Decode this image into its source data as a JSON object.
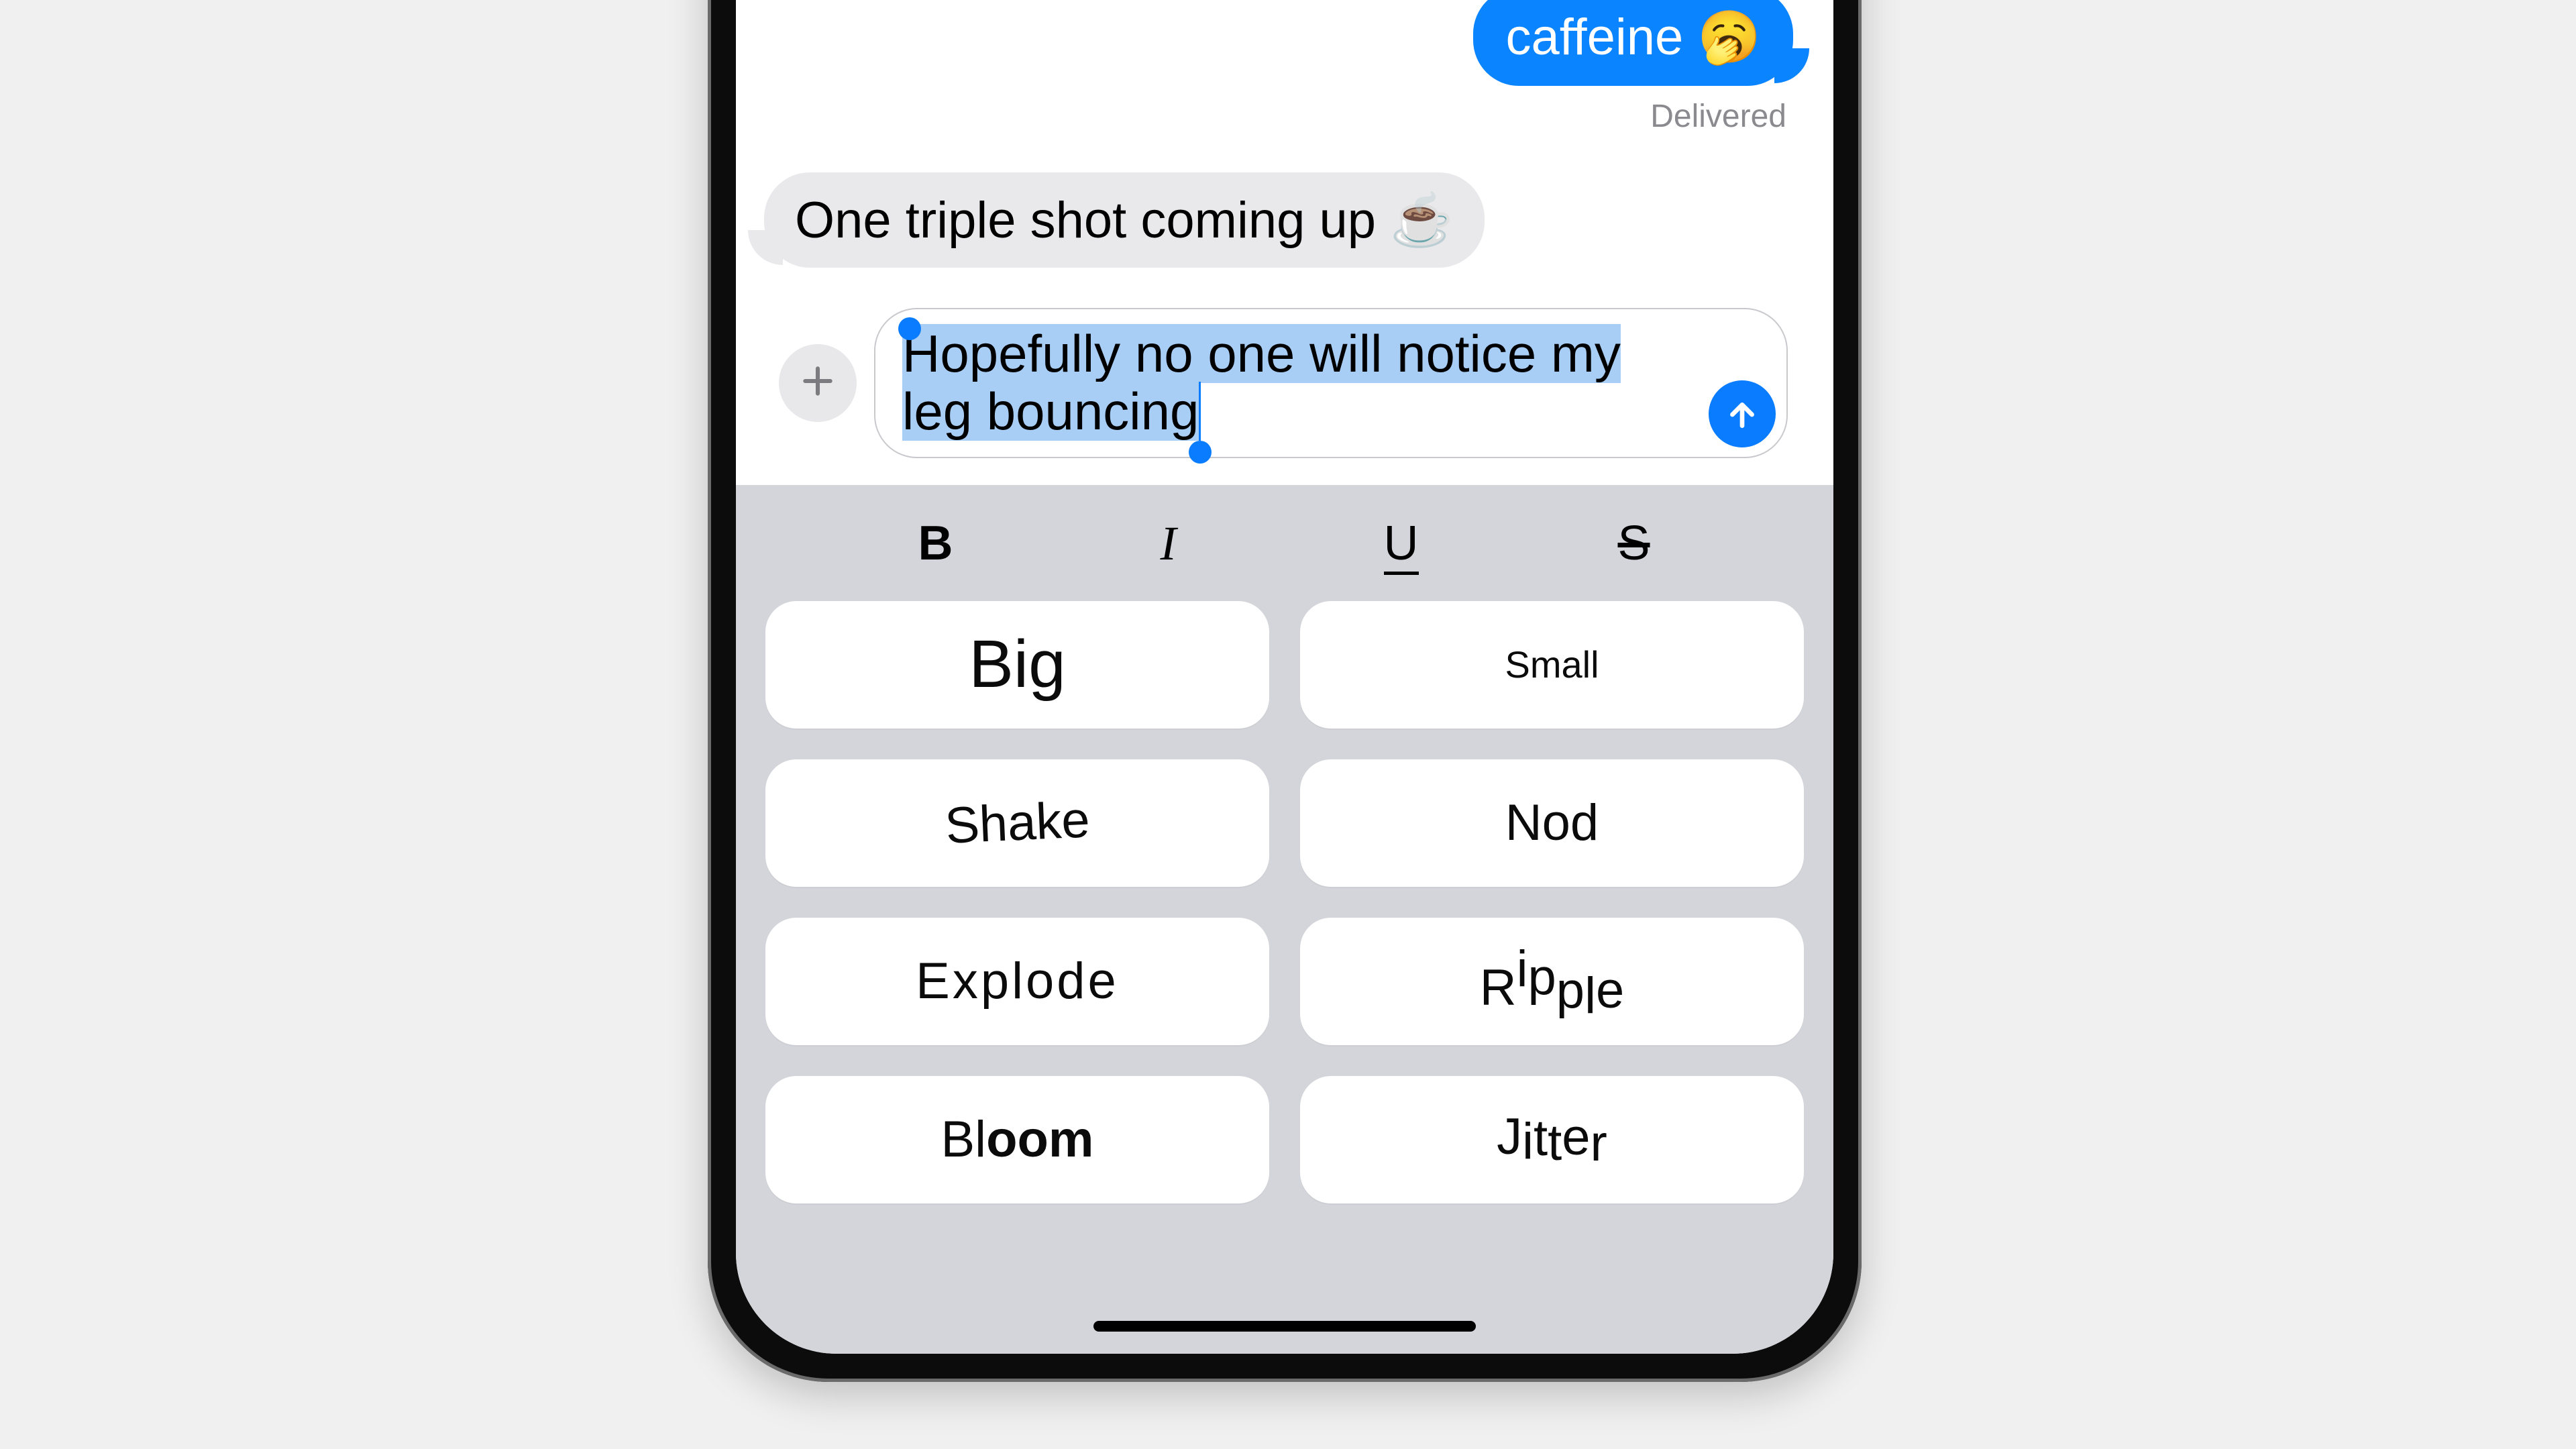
{
  "conversation": {
    "sent_bubble_partial": "caffeine 🥱",
    "delivered_label": "Delivered",
    "received_bubble": "One triple shot coming up ☕",
    "compose_text": "Hopefully no one will notice my leg ",
    "compose_selected_word": "bouncing"
  },
  "format_row": {
    "bold": "B",
    "italic": "I",
    "underline": "U",
    "strike": "S"
  },
  "effects": {
    "big": "Big",
    "small": "Small",
    "shake": "Shake",
    "nod": "Nod",
    "explode": "Explode",
    "ripple": "Ripple",
    "bloom": "Bloom",
    "jitter": "Jitter"
  },
  "colors": {
    "imessage_blue": "#0a84ff",
    "bubble_gray": "#e9e9eb",
    "panel_bg": "#d4d5da",
    "plus_bg": "#e8e8ea"
  }
}
